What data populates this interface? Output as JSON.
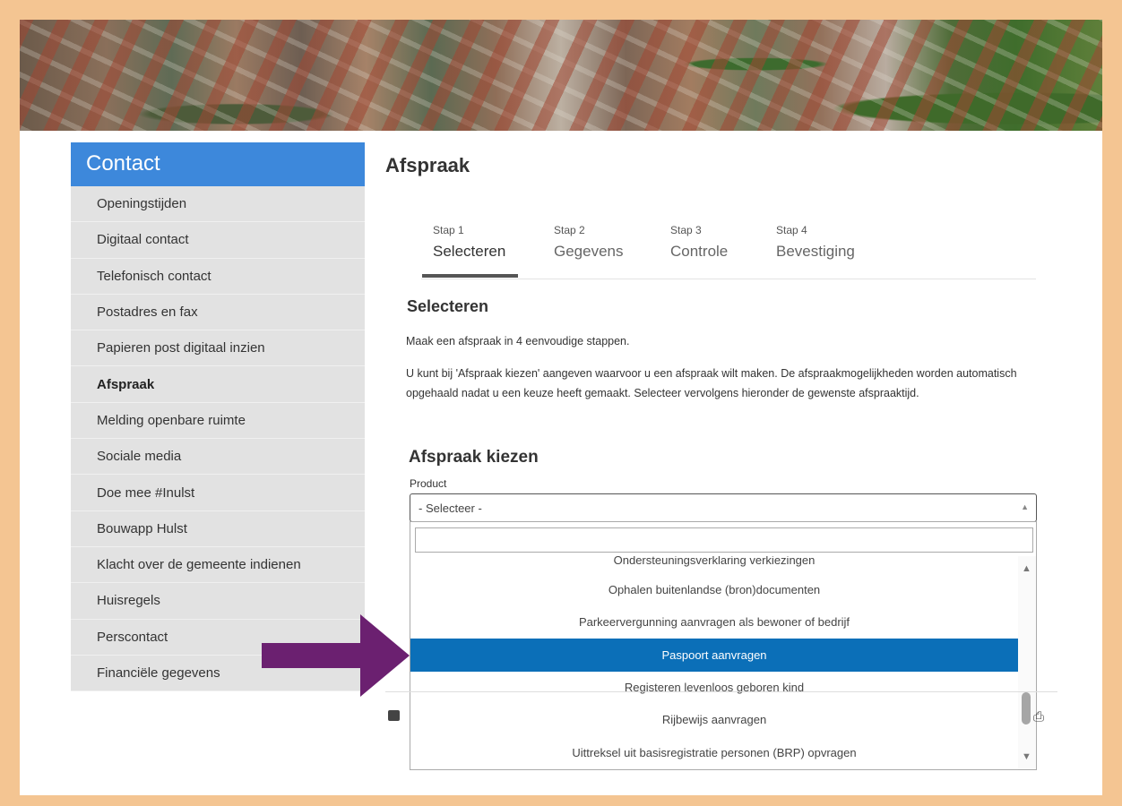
{
  "sidebar": {
    "title": "Contact",
    "items": [
      {
        "label": "Openingstijden"
      },
      {
        "label": "Digitaal contact"
      },
      {
        "label": "Telefonisch contact"
      },
      {
        "label": "Postadres en fax"
      },
      {
        "label": "Papieren post digitaal inzien"
      },
      {
        "label": "Afspraak",
        "active": true
      },
      {
        "label": "Melding openbare ruimte"
      },
      {
        "label": "Sociale media"
      },
      {
        "label": "Doe mee #Inulst"
      },
      {
        "label": "Bouwapp Hulst"
      },
      {
        "label": "Klacht over de gemeente indienen"
      },
      {
        "label": "Huisregels"
      },
      {
        "label": "Perscontact"
      },
      {
        "label": "Financiële gegevens"
      }
    ]
  },
  "main": {
    "title": "Afspraak",
    "steps": [
      {
        "num": "Stap 1",
        "label": "Selecteren",
        "active": true
      },
      {
        "num": "Stap 2",
        "label": "Gegevens"
      },
      {
        "num": "Stap 3",
        "label": "Controle"
      },
      {
        "num": "Stap 4",
        "label": "Bevestiging"
      }
    ],
    "section_title": "Selecteren",
    "intro": "Maak een afspraak in 4 eenvoudige stappen.",
    "description": "U kunt bij 'Afspraak kiezen' aangeven waarvoor u een afspraak wilt maken. De afspraakmogelijkheden worden automatisch opgehaald nadat u een keuze heeft gemaakt. Selecteer vervolgens hieronder de gewenste afspraaktijd.",
    "choose_title": "Afspraak kiezen",
    "product_label": "Product",
    "select_value": "- Selecteer -",
    "dropdown": {
      "search_value": "",
      "options": [
        {
          "label": "Ondersteuningsverklaring verkiezingen"
        },
        {
          "label": "Ophalen buitenlandse (bron)documenten"
        },
        {
          "label": "Parkeervergunning aanvragen als bewoner of bedrijf"
        },
        {
          "label": "Paspoort aanvragen",
          "selected": true
        },
        {
          "label": "Registeren levenloos geboren kind"
        },
        {
          "label": "Rijbewijs aanvragen"
        },
        {
          "label": "Uittreksel uit basisregistratie personen (BRP) opvragen"
        }
      ]
    }
  },
  "colors": {
    "frame": "#f4c592",
    "sidebar_header": "#3d88db",
    "selected_option": "#0b6fb8",
    "arrow": "#6b2070"
  },
  "icons": [
    "share-icon",
    "print-icon",
    "arrow-up-icon",
    "arrow-down-icon",
    "pointer-arrow"
  ]
}
